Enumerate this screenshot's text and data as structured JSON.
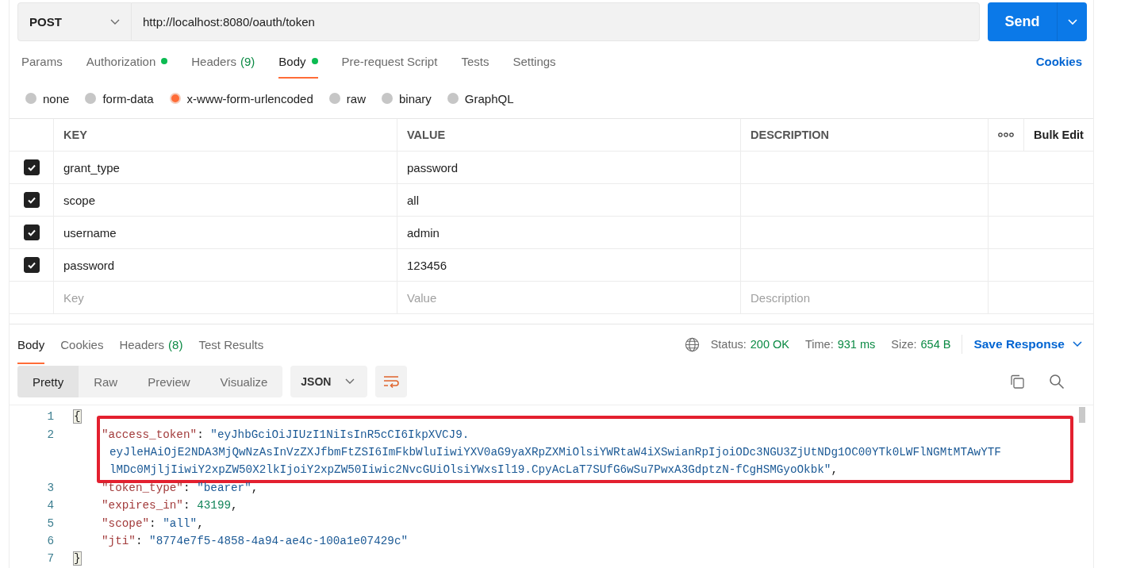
{
  "request": {
    "method": "POST",
    "url": "http://localhost:8080/oauth/token",
    "send_label": "Send"
  },
  "request_tabs": [
    {
      "label": "Params",
      "selected": false,
      "indicator": false
    },
    {
      "label": "Authorization",
      "selected": false,
      "indicator": true
    },
    {
      "label": "Headers",
      "count": "(9)",
      "selected": false,
      "indicator": false
    },
    {
      "label": "Body",
      "selected": true,
      "indicator": true
    },
    {
      "label": "Pre-request Script",
      "selected": false,
      "indicator": false
    },
    {
      "label": "Tests",
      "selected": false,
      "indicator": false
    },
    {
      "label": "Settings",
      "selected": false,
      "indicator": false
    }
  ],
  "cookies_link": "Cookies",
  "body_types": [
    {
      "label": "none",
      "selected": false
    },
    {
      "label": "form-data",
      "selected": false
    },
    {
      "label": "x-www-form-urlencoded",
      "selected": true
    },
    {
      "label": "raw",
      "selected": false
    },
    {
      "label": "binary",
      "selected": false
    },
    {
      "label": "GraphQL",
      "selected": false
    }
  ],
  "params_table": {
    "columns": [
      "KEY",
      "VALUE",
      "DESCRIPTION"
    ],
    "bulk_edit": "Bulk Edit",
    "rows": [
      {
        "key": "grant_type",
        "value": "password",
        "checked": true
      },
      {
        "key": "scope",
        "value": "all",
        "checked": true
      },
      {
        "key": "username",
        "value": "admin",
        "checked": true
      },
      {
        "key": "password",
        "value": "123456",
        "checked": true
      }
    ],
    "placeholder_row": {
      "key": "Key",
      "value": "Value",
      "description": "Description"
    }
  },
  "response_tabs": [
    {
      "label": "Body",
      "selected": true
    },
    {
      "label": "Cookies",
      "selected": false
    },
    {
      "label": "Headers",
      "count": "(8)",
      "selected": false
    },
    {
      "label": "Test Results",
      "selected": false
    }
  ],
  "status": [
    {
      "label": "Status:",
      "value": "200 OK"
    },
    {
      "label": "Time:",
      "value": "931 ms"
    },
    {
      "label": "Size:",
      "value": "654 B"
    }
  ],
  "save_response": "Save Response",
  "view_modes": [
    {
      "label": "Pretty",
      "selected": true
    },
    {
      "label": "Raw",
      "selected": false
    },
    {
      "label": "Preview",
      "selected": false
    },
    {
      "label": "Visualize",
      "selected": false
    }
  ],
  "format": "JSON",
  "code": {
    "lines": [
      {
        "number": "1",
        "highlighted": false,
        "rows": [
          [
            {
              "kind": "brace",
              "text": "{"
            }
          ]
        ]
      },
      {
        "number": "2",
        "highlighted": true,
        "rows": [
          [
            {
              "kind": "key",
              "text": "\"access_token\""
            },
            {
              "kind": "punct",
              "text": ": "
            },
            {
              "kind": "string",
              "text": "\"eyJhbGciOiJIUzI1NiIsInR5cCI6IkpXVCJ9."
            }
          ]
        ],
        "wrapped": [
          {
            "segments": [
              {
                "kind": "string",
                "text": "eyJleHAiOjE2NDA3MjQwNzAsInVzZXJfbmFtZSI6ImFkbWluIiwiYXV0aG9yaXRpZXMiOlsiYWRtaW4iXSwianRpIjoiODc3NGU3ZjUtNDg1OC00YTk0LWFlNGMtMTAwYTF"
              }
            ]
          },
          {
            "segments": [
              {
                "kind": "string",
                "text": "lMDc0MjljIiwiY2xpZW50X2lkIjoiY2xpZW50Iiwic2NvcGUiOlsiYWxsIl19.CpyAcLaT7SUfG6wSu7PwxA3GdptzN-fCgHSMGyoOkbk\""
              },
              {
                "kind": "punct",
                "text": ","
              }
            ]
          }
        ]
      },
      {
        "number": "3",
        "highlighted": false,
        "rows": [
          [
            {
              "kind": "key",
              "text": "\"token_type\""
            },
            {
              "kind": "punct",
              "text": ": "
            },
            {
              "kind": "string",
              "text": "\"bearer\""
            },
            {
              "kind": "punct",
              "text": ","
            }
          ]
        ]
      },
      {
        "number": "4",
        "highlighted": false,
        "rows": [
          [
            {
              "kind": "key",
              "text": "\"expires_in\""
            },
            {
              "kind": "punct",
              "text": ": "
            },
            {
              "kind": "number",
              "text": "43199"
            },
            {
              "kind": "punct",
              "text": ","
            }
          ]
        ]
      },
      {
        "number": "5",
        "highlighted": false,
        "rows": [
          [
            {
              "kind": "key",
              "text": "\"scope\""
            },
            {
              "kind": "punct",
              "text": ": "
            },
            {
              "kind": "string",
              "text": "\"all\""
            },
            {
              "kind": "punct",
              "text": ","
            }
          ]
        ]
      },
      {
        "number": "6",
        "highlighted": false,
        "rows": [
          [
            {
              "kind": "key",
              "text": "\"jti\""
            },
            {
              "kind": "punct",
              "text": ": "
            },
            {
              "kind": "string",
              "text": "\"8774e7f5-4858-4a94-ae4c-100a1e07429c\""
            }
          ]
        ]
      },
      {
        "number": "7",
        "highlighted": false,
        "rows": [
          [
            {
              "kind": "brace",
              "text": "}"
            }
          ]
        ]
      }
    ]
  }
}
